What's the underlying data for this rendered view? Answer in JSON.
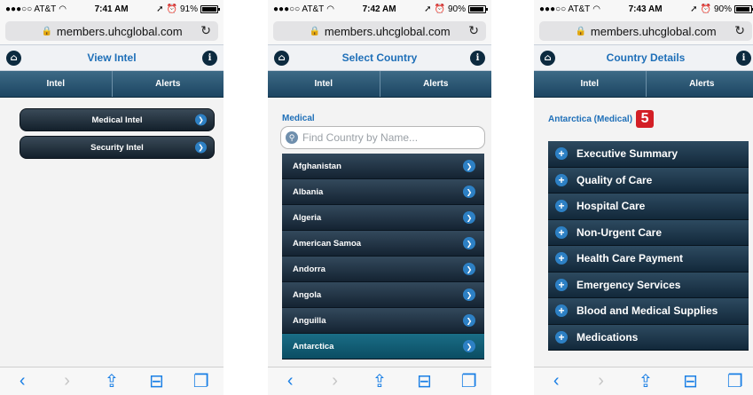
{
  "screens": [
    {
      "status": {
        "carrier": "●●●○○ AT&T",
        "time": "7:41 AM",
        "battery": "91%",
        "battery_level": 0.91
      },
      "url": "members.uhcglobal.com",
      "header_title": "View Intel",
      "tabs": [
        "Intel",
        "Alerts"
      ],
      "menu": [
        "Medical Intel",
        "Security Intel"
      ]
    },
    {
      "status": {
        "carrier": "●●●○○ AT&T",
        "time": "7:42 AM",
        "battery": "90%",
        "battery_level": 0.9
      },
      "url": "members.uhcglobal.com",
      "header_title": "Select Country",
      "tabs": [
        "Intel",
        "Alerts"
      ],
      "section": "Medical",
      "search_placeholder": "Find Country by Name...",
      "countries": [
        "Afghanistan",
        "Albania",
        "Algeria",
        "American Samoa",
        "Andorra",
        "Angola",
        "Anguilla",
        "Antarctica"
      ]
    },
    {
      "status": {
        "carrier": "●●●○○ AT&T",
        "time": "7:43 AM",
        "battery": "90%",
        "battery_level": 0.9
      },
      "url": "members.uhcglobal.com",
      "header_title": "Country Details",
      "tabs": [
        "Intel",
        "Alerts"
      ],
      "country_label": "Antarctica (Medical)",
      "rating": "5",
      "sections": [
        "Executive Summary",
        "Quality of Care",
        "Hospital Care",
        "Non-Urgent Care",
        "Health Care Payment",
        "Emergency Services",
        "Blood and Medical Supplies",
        "Medications"
      ]
    }
  ],
  "colors": {
    "accent_blue": "#1e6fb8",
    "rating_red": "#d31f26",
    "ios_blue": "#1a7fe5"
  },
  "icons": {
    "home": "home-icon",
    "info": "info-icon",
    "back": "back-icon",
    "forward": "forward-icon",
    "share": "share-icon",
    "bookmarks": "bookmarks-icon",
    "tabs": "tabs-icon"
  }
}
